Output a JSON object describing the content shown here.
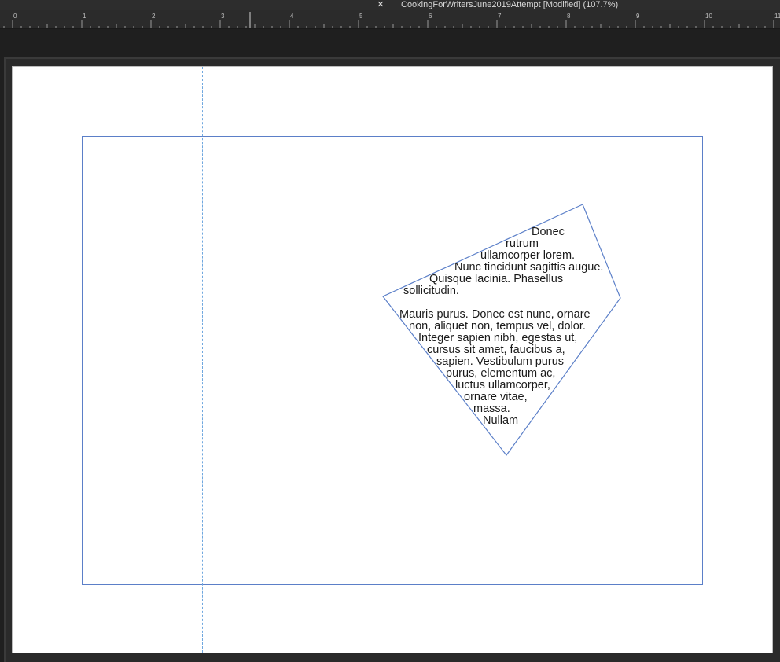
{
  "tab": {
    "close_glyph": "✕",
    "title": "CookingForWritersJune2019Attempt [Modified] (107.7%)"
  },
  "ruler": {
    "labels": [
      "0",
      "1",
      "2",
      "3",
      "4",
      "5",
      "6",
      "7",
      "8",
      "9",
      "10",
      "11"
    ]
  },
  "text_frame": {
    "lines": [
      "Donec",
      "rutrum",
      "ullamcorper lorem.",
      "Nunc tincidunt sagittis augue.",
      "Quisque lacinia. Phasellus",
      "sollicitudin.",
      "",
      "Mauris purus. Donec est nunc, ornare",
      "non, aliquet non, tempus vel, dolor.",
      "Integer sapien nibh, egestas ut,",
      "cursus sit amet, faucibus a,",
      "sapien. Vestibulum purus",
      "purus, elementum ac,",
      "luctus ullamcorper,",
      "ornare vitae,",
      "massa.",
      "Nullam"
    ]
  },
  "colors": {
    "frame_stroke": "#5b7fc8",
    "guide": "#6fa7df",
    "page": "#ffffff",
    "pasteboard": "#2a2a2a"
  }
}
